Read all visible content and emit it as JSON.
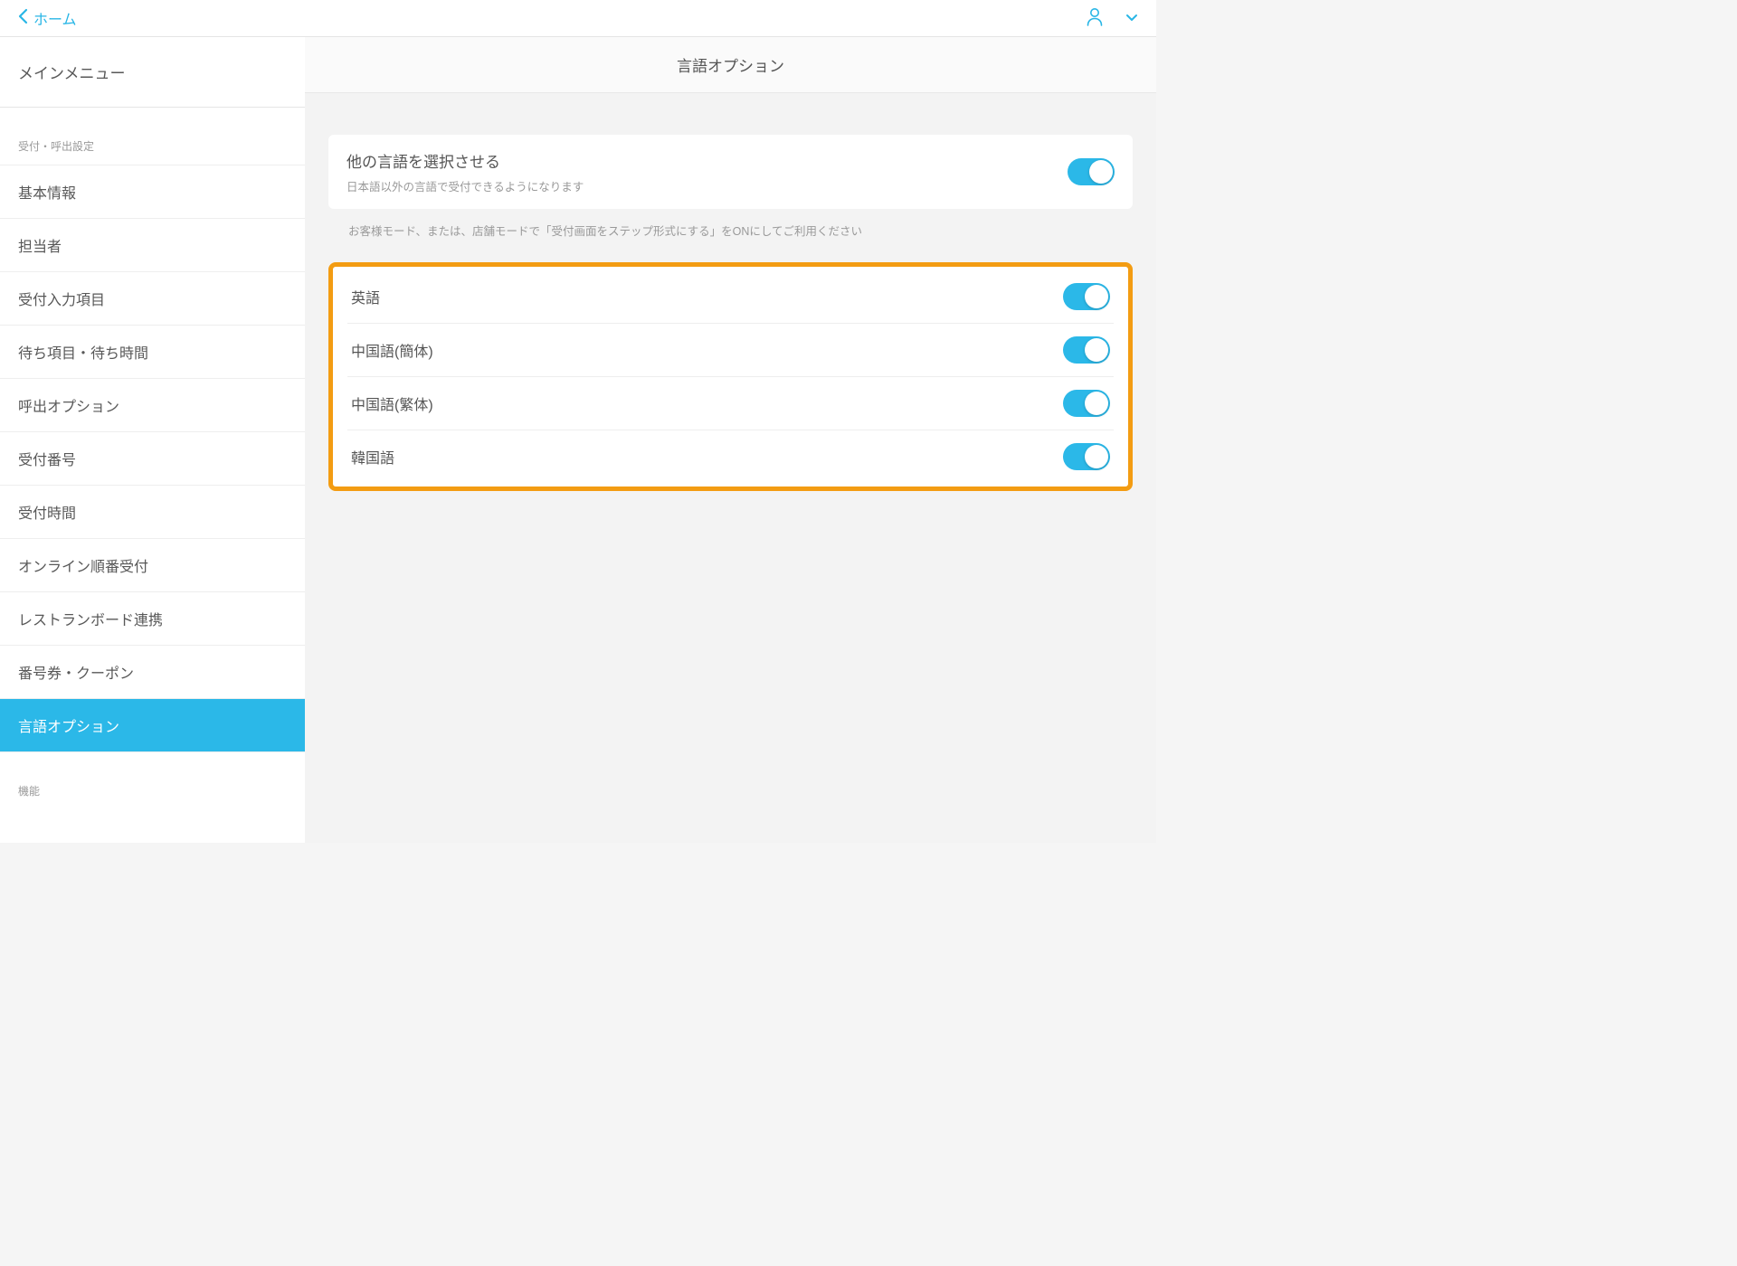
{
  "header": {
    "back_label": "ホーム"
  },
  "sidebar": {
    "main_menu": "メインメニュー",
    "section1_label": "受付・呼出設定",
    "items": [
      "基本情報",
      "担当者",
      "受付入力項目",
      "待ち項目・待ち時間",
      "呼出オプション",
      "受付番号",
      "受付時間",
      "オンライン順番受付",
      "レストランボード連携",
      "番号券・クーポン",
      "言語オプション"
    ],
    "section2_label": "機能"
  },
  "main": {
    "title": "言語オプション",
    "card": {
      "title": "他の言語を選択させる",
      "subtitle": "日本語以外の言語で受付できるようになります"
    },
    "hint": "お客様モード、または、店舗モードで「受付画面をステップ形式にする」をONにしてご利用ください",
    "languages": [
      {
        "label": "英語",
        "on": true
      },
      {
        "label": "中国語(簡体)",
        "on": true
      },
      {
        "label": "中国語(繁体)",
        "on": true
      },
      {
        "label": "韓国語",
        "on": true
      }
    ]
  },
  "colors": {
    "accent": "#2bb8e8",
    "highlight_border": "#f39c12"
  }
}
